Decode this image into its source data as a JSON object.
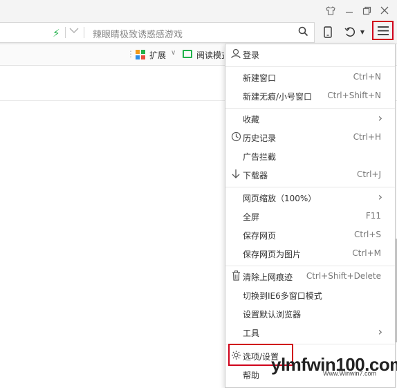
{
  "window": {
    "skin_icon": "shirt-icon",
    "min_icon": "minimize-icon",
    "restore_icon": "restore-icon",
    "close_icon": "close-icon"
  },
  "addressbar": {
    "search_text": "辣眼睛极致诱惑感游戏"
  },
  "favbar": {
    "extensions_label": "扩展",
    "reading_label": "阅读模式"
  },
  "menu": {
    "login_label": "登录",
    "items": [
      {
        "label": "新建窗口",
        "shortcut": "Ctrl+N"
      },
      {
        "label": "新建无痕/小号窗口",
        "shortcut": "Ctrl+Shift+N"
      },
      {
        "label": "收藏",
        "shortcut": ""
      },
      {
        "label": "历史记录",
        "shortcut": "Ctrl+H"
      },
      {
        "label": "广告拦截",
        "shortcut": ""
      },
      {
        "label": "下载器",
        "shortcut": "Ctrl+J"
      },
      {
        "label": "网页缩放（100%）",
        "shortcut": ""
      },
      {
        "label": "全屏",
        "shortcut": "F11"
      },
      {
        "label": "保存网页",
        "shortcut": "Ctrl+S"
      },
      {
        "label": "保存网页为图片",
        "shortcut": "Ctrl+M"
      },
      {
        "label": "清除上网痕迹",
        "shortcut": "Ctrl+Shift+Delete"
      },
      {
        "label": "切换到IE6多窗口模式",
        "shortcut": ""
      },
      {
        "label": "设置默认浏览器",
        "shortcut": ""
      },
      {
        "label": "工具",
        "shortcut": ""
      },
      {
        "label": "选项/设置",
        "shortcut": ""
      },
      {
        "label": "帮助",
        "shortcut": ""
      }
    ]
  },
  "watermark": {
    "main": "ylmfwin100.com",
    "sub": "Www.Winwin7.com"
  },
  "colors": {
    "highlight_border": "#d0021b",
    "accent_green": "#21b24b"
  }
}
